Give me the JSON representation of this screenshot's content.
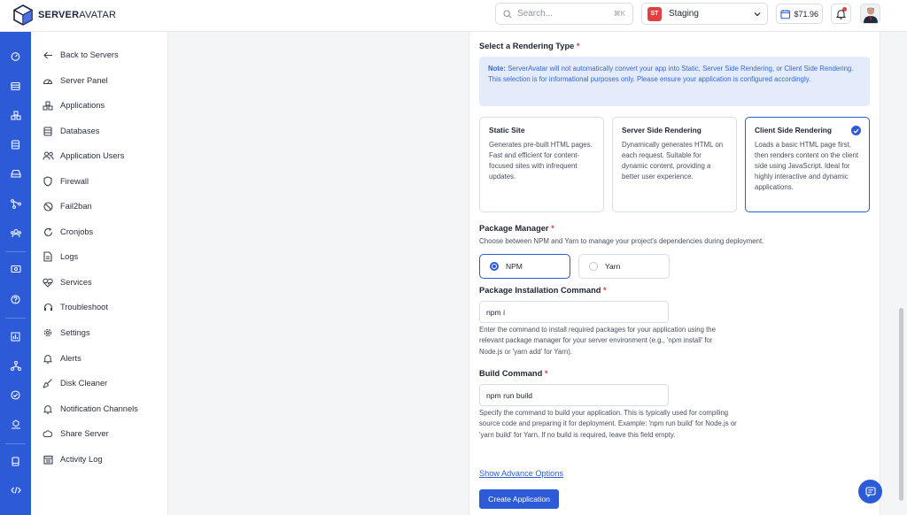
{
  "brand": {
    "name_a": "SERVER",
    "name_b": "AVATAR"
  },
  "topbar": {
    "search_placeholder": "Search...",
    "search_shortcut": "⌘K",
    "workspace_badge": "ST",
    "workspace_name": "Staging",
    "credit": "$71.96"
  },
  "menu": [
    {
      "label": "Back to Servers",
      "icon": "arrow-left-icon"
    },
    {
      "label": "Server Panel",
      "icon": "gauge-icon"
    },
    {
      "label": "Applications",
      "icon": "cubes-icon"
    },
    {
      "label": "Databases",
      "icon": "database-icon"
    },
    {
      "label": "Application Users",
      "icon": "users-icon"
    },
    {
      "label": "Firewall",
      "icon": "shield-icon"
    },
    {
      "label": "Fail2ban",
      "icon": "ban-icon"
    },
    {
      "label": "Cronjobs",
      "icon": "refresh-icon"
    },
    {
      "label": "Logs",
      "icon": "file-icon"
    },
    {
      "label": "Services",
      "icon": "heart-pulse-icon"
    },
    {
      "label": "Troubleshoot",
      "icon": "headset-icon"
    },
    {
      "label": "Settings",
      "icon": "gear-icon"
    },
    {
      "label": "Alerts",
      "icon": "bell-icon"
    },
    {
      "label": "Disk Cleaner",
      "icon": "broom-icon"
    },
    {
      "label": "Notification Channels",
      "icon": "bell-icon"
    },
    {
      "label": "Share Server",
      "icon": "share-icon"
    },
    {
      "label": "Activity Log",
      "icon": "calendar-icon"
    }
  ],
  "rendering": {
    "heading": "Select a Rendering Type",
    "note_label": "Note:",
    "note_text": " ServerAvatar will not automatically convert your app into Static, Server Side Rendering, or Client Side Rendering. This selection is for informational purposes only. Please ensure your application is configured accordingly.",
    "options": [
      {
        "title": "Static Site",
        "desc": "Generates pre-built HTML pages. Fast and efficient for content-focused sites with infrequent updates."
      },
      {
        "title": "Server Side Rendering",
        "desc": "Dynamically generates HTML on each request. Suitable for dynamic content, providing a better user experience."
      },
      {
        "title": "Client Side Rendering",
        "desc": "Loads a basic HTML page first, then renders content on the client side using JavaScript. Ideal for highly interactive and dynamic applications."
      }
    ],
    "selected": "Client Side Rendering"
  },
  "package_manager": {
    "heading": "Package Manager",
    "desc": "Choose between NPM and Yarn to manage your project's dependencies during deployment.",
    "options": [
      "NPM",
      "Yarn"
    ],
    "selected": "NPM"
  },
  "install_command": {
    "heading": "Package Installation Command",
    "value": "npm i",
    "help": "Enter the command to install required packages for your application using the relevant package manager for your server environment (e.g., 'npm install' for Node.js or 'yarn add' for Yarn)."
  },
  "build_command": {
    "heading": "Build Command",
    "value": "npm run build",
    "help": "Specify the command to build your application. This is typically used for compiling source code and preparing it for deployment. Example: 'npm run build' for Node.js or 'yarn build' for Yarn. If no build is required, leave this field empty."
  },
  "advance_link": "Show Advance Options",
  "create_button": "Create Application",
  "required_mark": "*",
  "colors": {
    "accent": "#2d5bd7",
    "required": "#e0413f",
    "note_bg": "#e4ecfc"
  }
}
